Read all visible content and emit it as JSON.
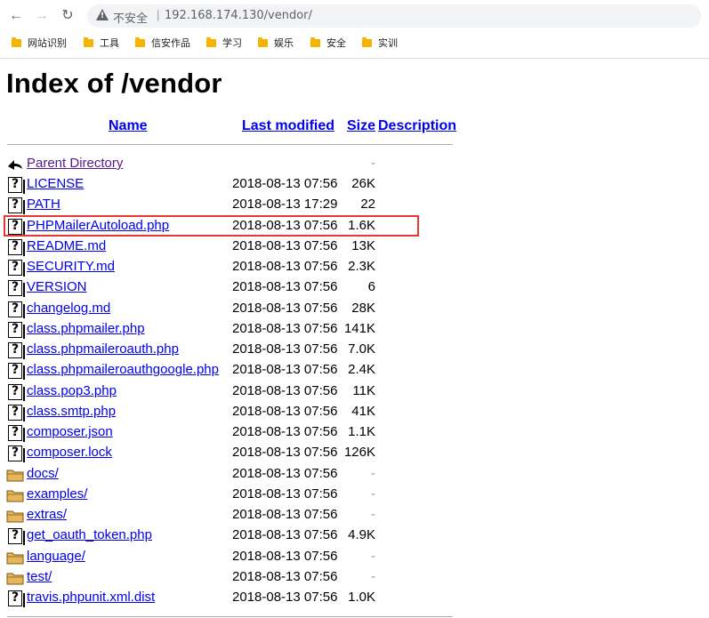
{
  "browser": {
    "insecure_label": "不安全",
    "separator": "|",
    "url": "192.168.174.130/vendor/",
    "bookmarks": [
      "网站识别",
      "工具",
      "信安作品",
      "学习",
      "娱乐",
      "安全",
      "实训"
    ]
  },
  "page": {
    "title": "Index of /vendor",
    "columns": {
      "name": "Name",
      "last_modified": "Last modified",
      "size": "Size",
      "description": "Description"
    },
    "parent_directory": {
      "name": "Parent Directory",
      "size": "-"
    },
    "entries": [
      {
        "name": "LICENSE",
        "date": "2018-08-13 07:56",
        "size": "26K",
        "icon": "unknown-file-icon"
      },
      {
        "name": "PATH",
        "date": "2018-08-13 17:29",
        "size": "22",
        "icon": "unknown-file-icon"
      },
      {
        "name": "PHPMailerAutoload.php",
        "date": "2018-08-13 07:56",
        "size": "1.6K",
        "icon": "unknown-file-icon",
        "highlighted": true
      },
      {
        "name": "README.md",
        "date": "2018-08-13 07:56",
        "size": "13K",
        "icon": "unknown-file-icon"
      },
      {
        "name": "SECURITY.md",
        "date": "2018-08-13 07:56",
        "size": "2.3K",
        "icon": "unknown-file-icon"
      },
      {
        "name": "VERSION",
        "date": "2018-08-13 07:56",
        "size": "6",
        "icon": "unknown-file-icon"
      },
      {
        "name": "changelog.md",
        "date": "2018-08-13 07:56",
        "size": "28K",
        "icon": "unknown-file-icon"
      },
      {
        "name": "class.phpmailer.php",
        "date": "2018-08-13 07:56",
        "size": "141K",
        "icon": "unknown-file-icon"
      },
      {
        "name": "class.phpmaileroauth.php",
        "date": "2018-08-13 07:56",
        "size": "7.0K",
        "icon": "unknown-file-icon"
      },
      {
        "name": "class.phpmaileroauthgoogle.php",
        "date": "2018-08-13 07:56",
        "size": "2.4K",
        "icon": "unknown-file-icon"
      },
      {
        "name": "class.pop3.php",
        "date": "2018-08-13 07:56",
        "size": "11K",
        "icon": "unknown-file-icon"
      },
      {
        "name": "class.smtp.php",
        "date": "2018-08-13 07:56",
        "size": "41K",
        "icon": "unknown-file-icon"
      },
      {
        "name": "composer.json",
        "date": "2018-08-13 07:56",
        "size": "1.1K",
        "icon": "unknown-file-icon"
      },
      {
        "name": "composer.lock",
        "date": "2018-08-13 07:56",
        "size": "126K",
        "icon": "unknown-file-icon"
      },
      {
        "name": "docs/",
        "date": "2018-08-13 07:56",
        "size": "-",
        "icon": "folder-icon"
      },
      {
        "name": "examples/",
        "date": "2018-08-13 07:56",
        "size": "-",
        "icon": "folder-icon"
      },
      {
        "name": "extras/",
        "date": "2018-08-13 07:56",
        "size": "-",
        "icon": "folder-icon"
      },
      {
        "name": "get_oauth_token.php",
        "date": "2018-08-13 07:56",
        "size": "4.9K",
        "icon": "unknown-file-icon"
      },
      {
        "name": "language/",
        "date": "2018-08-13 07:56",
        "size": "-",
        "icon": "folder-icon"
      },
      {
        "name": "test/",
        "date": "2018-08-13 07:56",
        "size": "-",
        "icon": "folder-icon"
      },
      {
        "name": "travis.phpunit.xml.dist",
        "date": "2018-08-13 07:56",
        "size": "1.0K",
        "icon": "unknown-file-icon"
      }
    ]
  }
}
